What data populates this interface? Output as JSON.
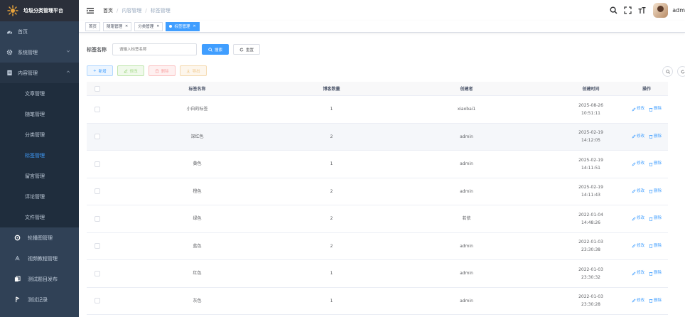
{
  "app": {
    "title": "垃圾分类管理平台"
  },
  "sidebar": {
    "items": [
      {
        "label": "首页",
        "icon": "dashboard-icon"
      },
      {
        "label": "系统管理",
        "icon": "gear-icon"
      },
      {
        "label": "内容管理",
        "icon": "document-icon"
      }
    ],
    "sub_items": [
      {
        "label": "文章管理"
      },
      {
        "label": "随笔管理"
      },
      {
        "label": "分类管理"
      },
      {
        "label": "标签管理"
      },
      {
        "label": "留言管理"
      },
      {
        "label": "评论管理"
      },
      {
        "label": "文件管理"
      }
    ],
    "bottom_items": [
      {
        "label": "轮播图管理",
        "icon": "carousel-icon"
      },
      {
        "label": "视频教程管理",
        "icon": "video-icon"
      },
      {
        "label": "测试题目发布",
        "icon": "copy-icon"
      },
      {
        "label": "测试记录",
        "icon": "record-icon"
      }
    ]
  },
  "breadcrumb": {
    "items": [
      "首页",
      "内容管理",
      "标签管理"
    ]
  },
  "user": {
    "name": "adm"
  },
  "tags_view": {
    "tabs": [
      "首页",
      "随笔管理",
      "分类管理",
      "标签管理"
    ]
  },
  "search": {
    "label": "标签名称",
    "placeholder": "请输入标签名称",
    "search_btn": "搜索",
    "reset_btn": "重置"
  },
  "toolbar": {
    "add": "新增",
    "edit": "修改",
    "delete": "删除",
    "export": "导出"
  },
  "table": {
    "headers": {
      "name": "标签名称",
      "blog_count": "博客数量",
      "creator": "创建者",
      "created_at": "创建时间",
      "actions": "操作"
    },
    "rows": [
      {
        "name": "小白的标签",
        "count": "1",
        "creator": "xiaobai1",
        "date": "2025-08-26",
        "time": "10:51:11"
      },
      {
        "name": "深红色",
        "count": "2",
        "creator": "admin",
        "date": "2025-02-19",
        "time": "14:12:05"
      },
      {
        "name": "黄色",
        "count": "1",
        "creator": "admin",
        "date": "2025-02-19",
        "time": "14:11:51"
      },
      {
        "name": "橙色",
        "count": "2",
        "creator": "admin",
        "date": "2025-02-19",
        "time": "14:11:43"
      },
      {
        "name": "绿色",
        "count": "2",
        "creator": "若依",
        "date": "2022-01-04",
        "time": "14:48:26"
      },
      {
        "name": "蓝色",
        "count": "2",
        "creator": "admin",
        "date": "2022-01-03",
        "time": "23:30:38"
      },
      {
        "name": "红色",
        "count": "1",
        "creator": "admin",
        "date": "2022-01-03",
        "time": "23:30:32"
      },
      {
        "name": "灰色",
        "count": "1",
        "creator": "admin",
        "date": "2022-01-03",
        "time": "23:30:28"
      }
    ],
    "row_actions": {
      "edit": "修改",
      "delete": "删除"
    }
  },
  "colors": {
    "primary": "#409eff",
    "sidebar_bg": "#304156",
    "sidebar_active": "#409eff"
  }
}
